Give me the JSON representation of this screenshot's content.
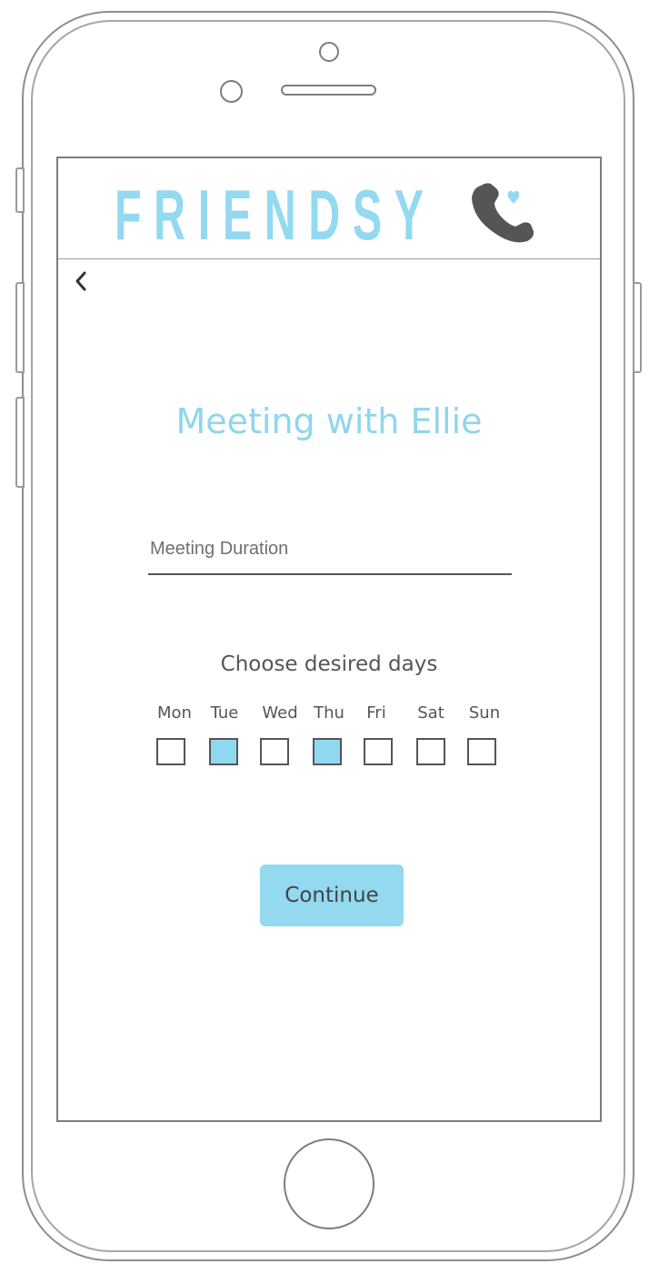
{
  "app": {
    "brand_name": "FRIENDSY",
    "brand_color": "#93d9f0",
    "icons": {
      "brand": "phone-heart-icon",
      "back": "chevron-left-icon"
    }
  },
  "page": {
    "title": "Meeting with Ellie"
  },
  "form": {
    "duration_placeholder": "Meeting Duration",
    "duration_value": "",
    "days_heading": "Choose desired days",
    "days": [
      {
        "label": "Mon",
        "checked": false
      },
      {
        "label": "Tue",
        "checked": true
      },
      {
        "label": "Wed",
        "checked": false
      },
      {
        "label": "Thu",
        "checked": true
      },
      {
        "label": "Fri",
        "checked": false
      },
      {
        "label": "Sat",
        "checked": false
      },
      {
        "label": "Sun",
        "checked": false
      }
    ],
    "checked_color": "#8ed9f0"
  },
  "actions": {
    "continue_label": "Continue"
  }
}
